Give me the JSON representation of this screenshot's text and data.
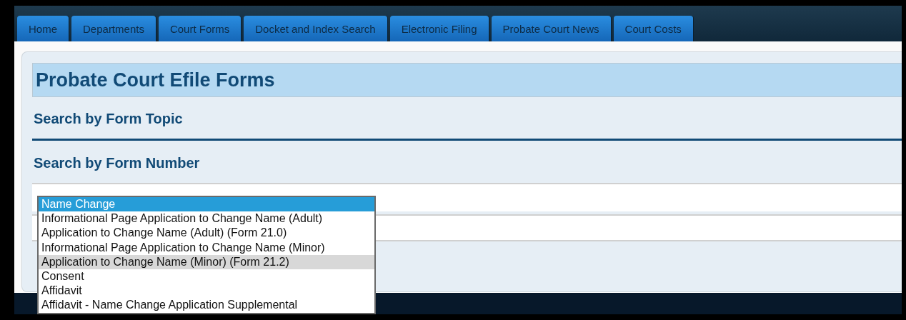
{
  "tabs": [
    {
      "label": "Home"
    },
    {
      "label": "Departments"
    },
    {
      "label": "Court Forms"
    },
    {
      "label": "Docket and Index Search"
    },
    {
      "label": "Electronic Filing"
    },
    {
      "label": "Probate Court News"
    },
    {
      "label": "Court Costs"
    }
  ],
  "page_title": "Probate Court Efile Forms",
  "sections": [
    {
      "heading": "Search by Form Topic"
    },
    {
      "heading": "Search by Form Number"
    }
  ],
  "dropdown": {
    "options": [
      {
        "label": "Name Change",
        "selected": true,
        "hovered": false
      },
      {
        "label": "Informational Page Application to Change Name (Adult)",
        "selected": false,
        "hovered": false
      },
      {
        "label": "Application to Change Name (Adult) (Form 21.0)",
        "selected": false,
        "hovered": false
      },
      {
        "label": "Informational Page Application to Change Name (Minor)",
        "selected": false,
        "hovered": false
      },
      {
        "label": "Application to Change Name (Minor) (Form 21.2)",
        "selected": false,
        "hovered": true
      },
      {
        "label": "Consent",
        "selected": false,
        "hovered": false
      },
      {
        "label": "Affidavit",
        "selected": false,
        "hovered": false
      },
      {
        "label": "Affidavit - Name Change Application Supplemental",
        "selected": false,
        "hovered": false
      }
    ]
  }
}
